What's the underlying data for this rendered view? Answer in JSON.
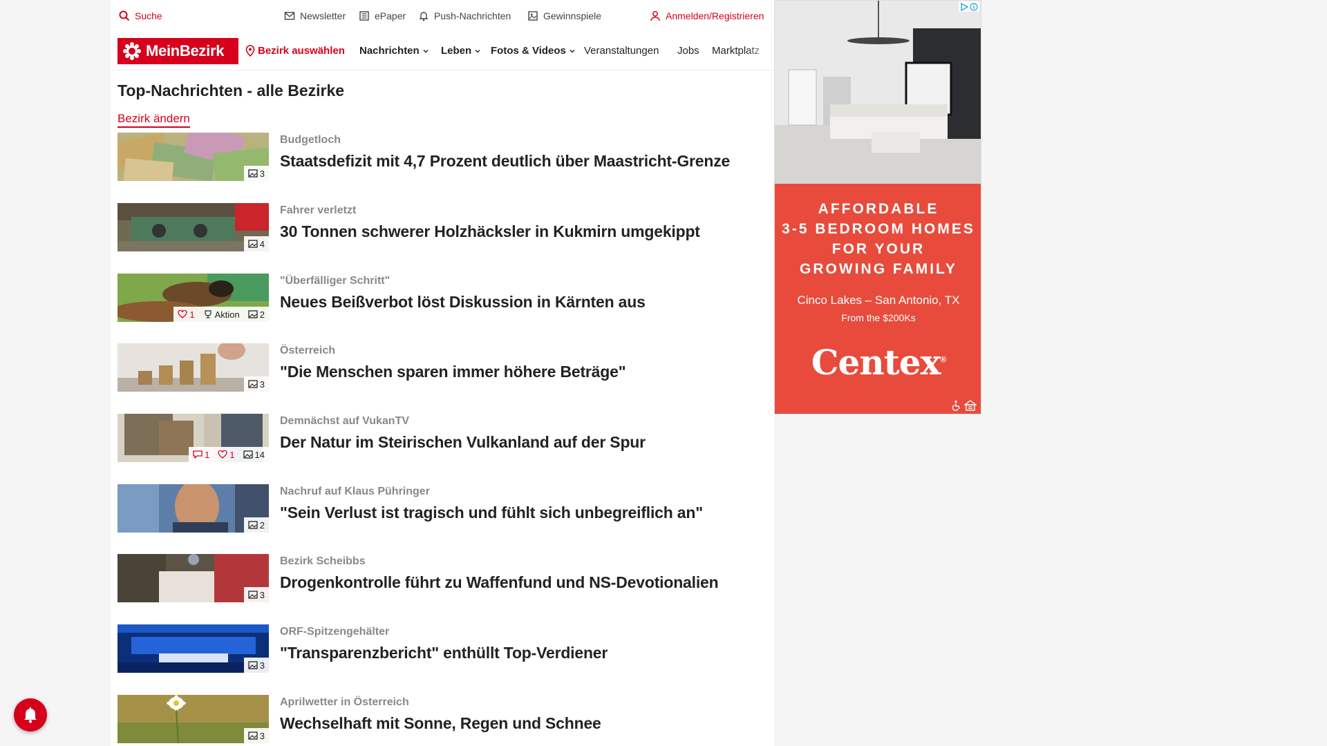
{
  "topbar": {
    "search": "Suche",
    "newsletter": "Newsletter",
    "epaper": "ePaper",
    "push": "Push-Nachrichten",
    "games": "Gewinnspiele",
    "login": "Anmelden/Registrieren"
  },
  "nav": {
    "logo": "MeinBezirk",
    "select_district": "Bezirk auswählen",
    "items": [
      "Nachrichten",
      "Leben",
      "Fotos & Videos",
      "Veranstaltungen",
      "Jobs",
      "Marktplatz"
    ]
  },
  "section": {
    "title": "Top-Nachrichten - alle Bezirke",
    "change_link": "Bezirk ändern"
  },
  "articles": [
    {
      "kicker": "Budgetloch",
      "headline": "Staatsdefizit mit 4,7 Prozent deutlich über Maastricht-Grenze",
      "images": "3"
    },
    {
      "kicker": "Fahrer verletzt",
      "headline": "30 Tonnen schwerer Holzhäcksler in Kukmirn umgekippt",
      "images": "4"
    },
    {
      "kicker": "\"Überfälliger Schritt\"",
      "headline": "Neues Beißverbot löst Diskussion in Kärnten aus",
      "likes": "1",
      "action": "Aktion",
      "images": "2"
    },
    {
      "kicker": "Österreich",
      "headline": "\"Die Menschen sparen immer höhere Beträge\"",
      "images": "3"
    },
    {
      "kicker": "Demnächst auf VukanTV",
      "headline": "Der Natur im Steirischen Vulkanland auf der Spur",
      "comments": "1",
      "likes": "1",
      "images": "14"
    },
    {
      "kicker": "Nachruf auf Klaus Pühringer",
      "headline": "\"Sein Verlust ist tragisch und fühlt sich unbegreiflich an\"",
      "images": "2"
    },
    {
      "kicker": "Bezirk Scheibbs",
      "headline": "Drogenkontrolle führt zu Waffenfund und NS-Devotionalien",
      "images": "3"
    },
    {
      "kicker": "ORF-Spitzengehälter",
      "headline": "\"Transparenzbericht\" enthüllt Top-Verdiener",
      "images": "3"
    },
    {
      "kicker": "Aprilwetter in Österreich",
      "headline": "Wechselhaft mit Sonne, Regen und Schnee",
      "images": "3"
    }
  ],
  "ad": {
    "headline_lines": [
      "AFFORDABLE",
      "3-5 BEDROOM HOMES",
      "FOR YOUR",
      "GROWING FAMILY"
    ],
    "location": "Cinco Lakes – San Antonio, TX",
    "price": "From the $200Ks",
    "brand": "Centex",
    "brand_mark": "®"
  },
  "colors": {
    "brand_red": "#d6001c",
    "ad_red": "#e84b3c"
  }
}
